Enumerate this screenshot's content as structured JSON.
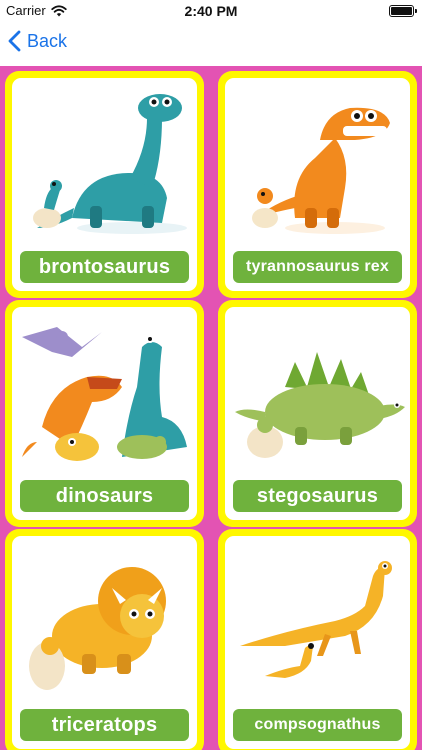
{
  "status_bar": {
    "carrier": "Carrier",
    "time": "2:40 PM"
  },
  "nav": {
    "back_label": "Back"
  },
  "cards": [
    {
      "label": "brontosaurus"
    },
    {
      "label": "tyrannosaurus rex"
    },
    {
      "label": "dinosaurs"
    },
    {
      "label": "stegosaurus"
    },
    {
      "label": "triceratops"
    },
    {
      "label": "compsognathus"
    }
  ],
  "colors": {
    "background": "#e353b3",
    "card_border": "#fff700",
    "label_bg": "#6fb23d",
    "link": "#1a73e8"
  }
}
